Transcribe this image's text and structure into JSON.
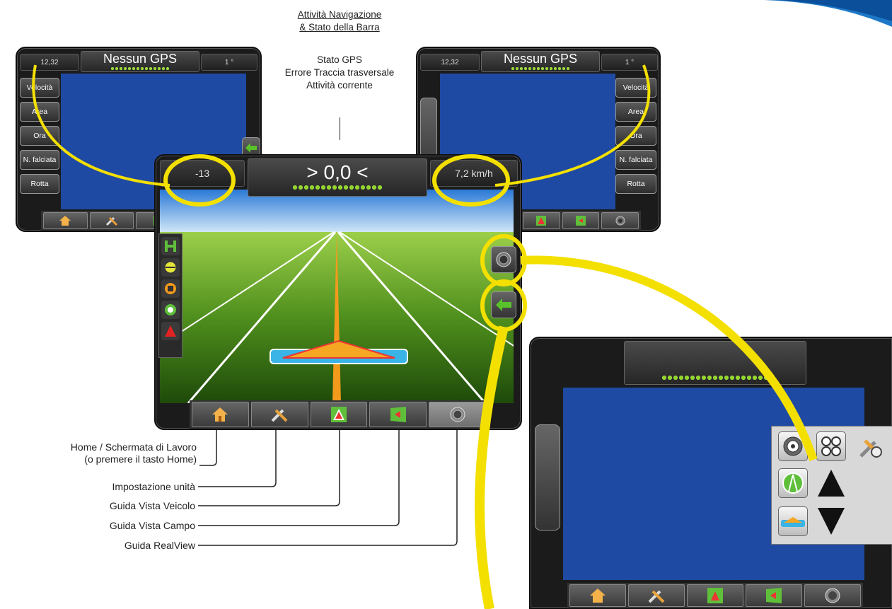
{
  "annotations": {
    "top_title_line1": "Attività Navigazione",
    "top_title_line2": "& Stato della Barra",
    "top_items": [
      "Stato GPS",
      "Errore Traccia trasversale",
      "Attività corrente"
    ],
    "left_labels": [
      "Home / Schermata di Lavoro",
      "(o premere il tasto Home)",
      "Impostazione unità",
      "Guida Vista Veicolo",
      "Guida Vista Campo",
      "Guida RealView"
    ]
  },
  "left_device": {
    "left_value": "12,32",
    "title": "Nessun GPS",
    "right_value": "1 °",
    "side_buttons": [
      "Velocità",
      "Area",
      "Ora",
      "N. falciata",
      "Rotta"
    ]
  },
  "right_device": {
    "left_value": "12,32",
    "title": "Nessun GPS",
    "right_value": "1 °",
    "side_buttons": [
      "Velocità",
      "Area",
      "Ora",
      "N. falciata",
      "Rotta"
    ]
  },
  "main_device": {
    "left_value": "-13",
    "center_value": "> 0,0 <",
    "right_value": "7,2 km/h"
  },
  "colors": {
    "highlight": "#f4e000",
    "screen_blue": "#1f4aa3",
    "gps_dot": "#8bd31f",
    "brand_swoosh": "#1e78c8"
  },
  "icons": {
    "bottom_bar": [
      "home-icon",
      "tools-icon",
      "vehicle-view-icon",
      "field-view-icon",
      "realview-camera-icon"
    ],
    "left_panel": [
      "boom-icon",
      "line-icon",
      "marker-icon",
      "steering-icon",
      "cone-icon"
    ]
  }
}
